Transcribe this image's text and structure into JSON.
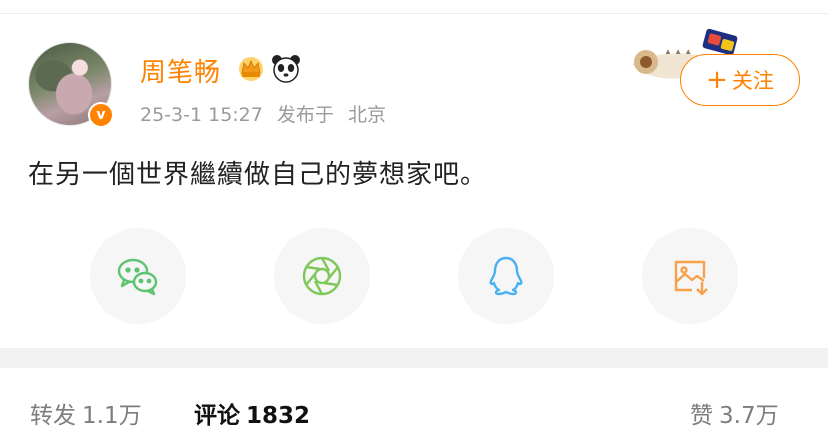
{
  "author": {
    "name": "周笔畅",
    "timestamp": "25-3-1 15:27",
    "location_prefix": "发布于",
    "location": "北京",
    "verified_mark": "v"
  },
  "follow_button": {
    "plus": "+",
    "label": "关注"
  },
  "post": {
    "text": "在另一個世界繼續做自己的夢想家吧。"
  },
  "share_row": [
    {
      "icon": "wechat-icon",
      "color": "#5cc46f"
    },
    {
      "icon": "moments-icon",
      "color": "#7ec85a"
    },
    {
      "icon": "qq-icon",
      "color": "#4ab1f0"
    },
    {
      "icon": "save-image-icon",
      "color": "#f5a24a"
    }
  ],
  "stats": {
    "repost_label": "转发",
    "repost_count": "1.1万",
    "comment_label": "评论",
    "comment_count": "1832",
    "like_label": "赞",
    "like_count": "3.7万"
  },
  "colors": {
    "accent": "#ff8200",
    "meta_text": "#9a9a9a",
    "band": "#f2f2f2"
  }
}
